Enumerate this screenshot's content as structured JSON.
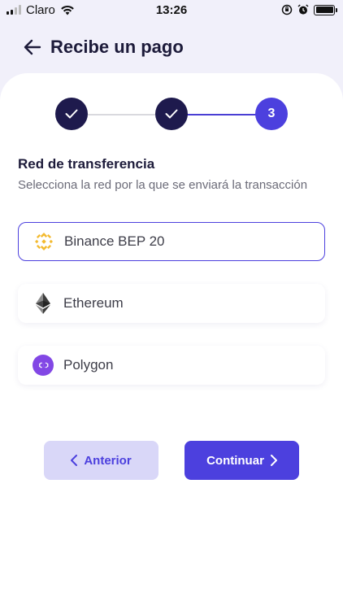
{
  "status_bar": {
    "carrier": "Claro",
    "time": "13:26"
  },
  "header": {
    "title": "Recibe un pago"
  },
  "stepper": {
    "steps": [
      {
        "state": "completed",
        "label": ""
      },
      {
        "state": "completed",
        "label": ""
      },
      {
        "state": "current",
        "label": "3"
      }
    ]
  },
  "section": {
    "title": "Red de transferencia",
    "subtitle": "Selecciona la red por la que se enviará la transacción"
  },
  "networks": [
    {
      "label": "Binance BEP 20",
      "icon": "binance-icon",
      "selected": true
    },
    {
      "label": "Ethereum",
      "icon": "ethereum-icon",
      "selected": false
    },
    {
      "label": "Polygon",
      "icon": "polygon-icon",
      "selected": false
    }
  ],
  "actions": {
    "previous_label": "Anterior",
    "next_label": "Continuar"
  },
  "colors": {
    "accent": "#4c40de",
    "completed_step": "#1e1a4d",
    "secondary_button_bg": "#d9d7f8",
    "background": "#f1f0fa",
    "binance_yellow": "#f3ba2f",
    "polygon_purple": "#8247e5"
  }
}
